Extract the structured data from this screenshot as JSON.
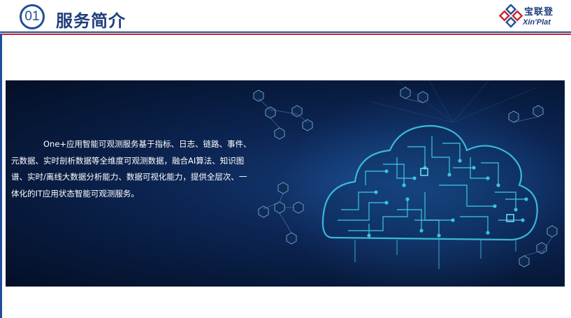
{
  "header": {
    "section_number": "01",
    "title": "服务简介"
  },
  "logo": {
    "cn": "宝联登",
    "en": "Xin'Plat"
  },
  "banner": {
    "description": "One+应用智能可观测服务基于指标、日志、链路、事件、元数据、实时剖析数据等全维度可观测数据，融合AI算法、知识图谱、实时/离线大数据分析能力、数据可视化能力，提供全层次、一体化的IT应用状态智能可观测服务。"
  },
  "colors": {
    "brand_blue": "#1f4f99",
    "accent_red": "#d21f26",
    "banner_dark": "#061634",
    "circuit_cyan": "#3fc7e6"
  },
  "icons": [
    "logo-mark-icon",
    "cloud-circuit-illustration"
  ]
}
